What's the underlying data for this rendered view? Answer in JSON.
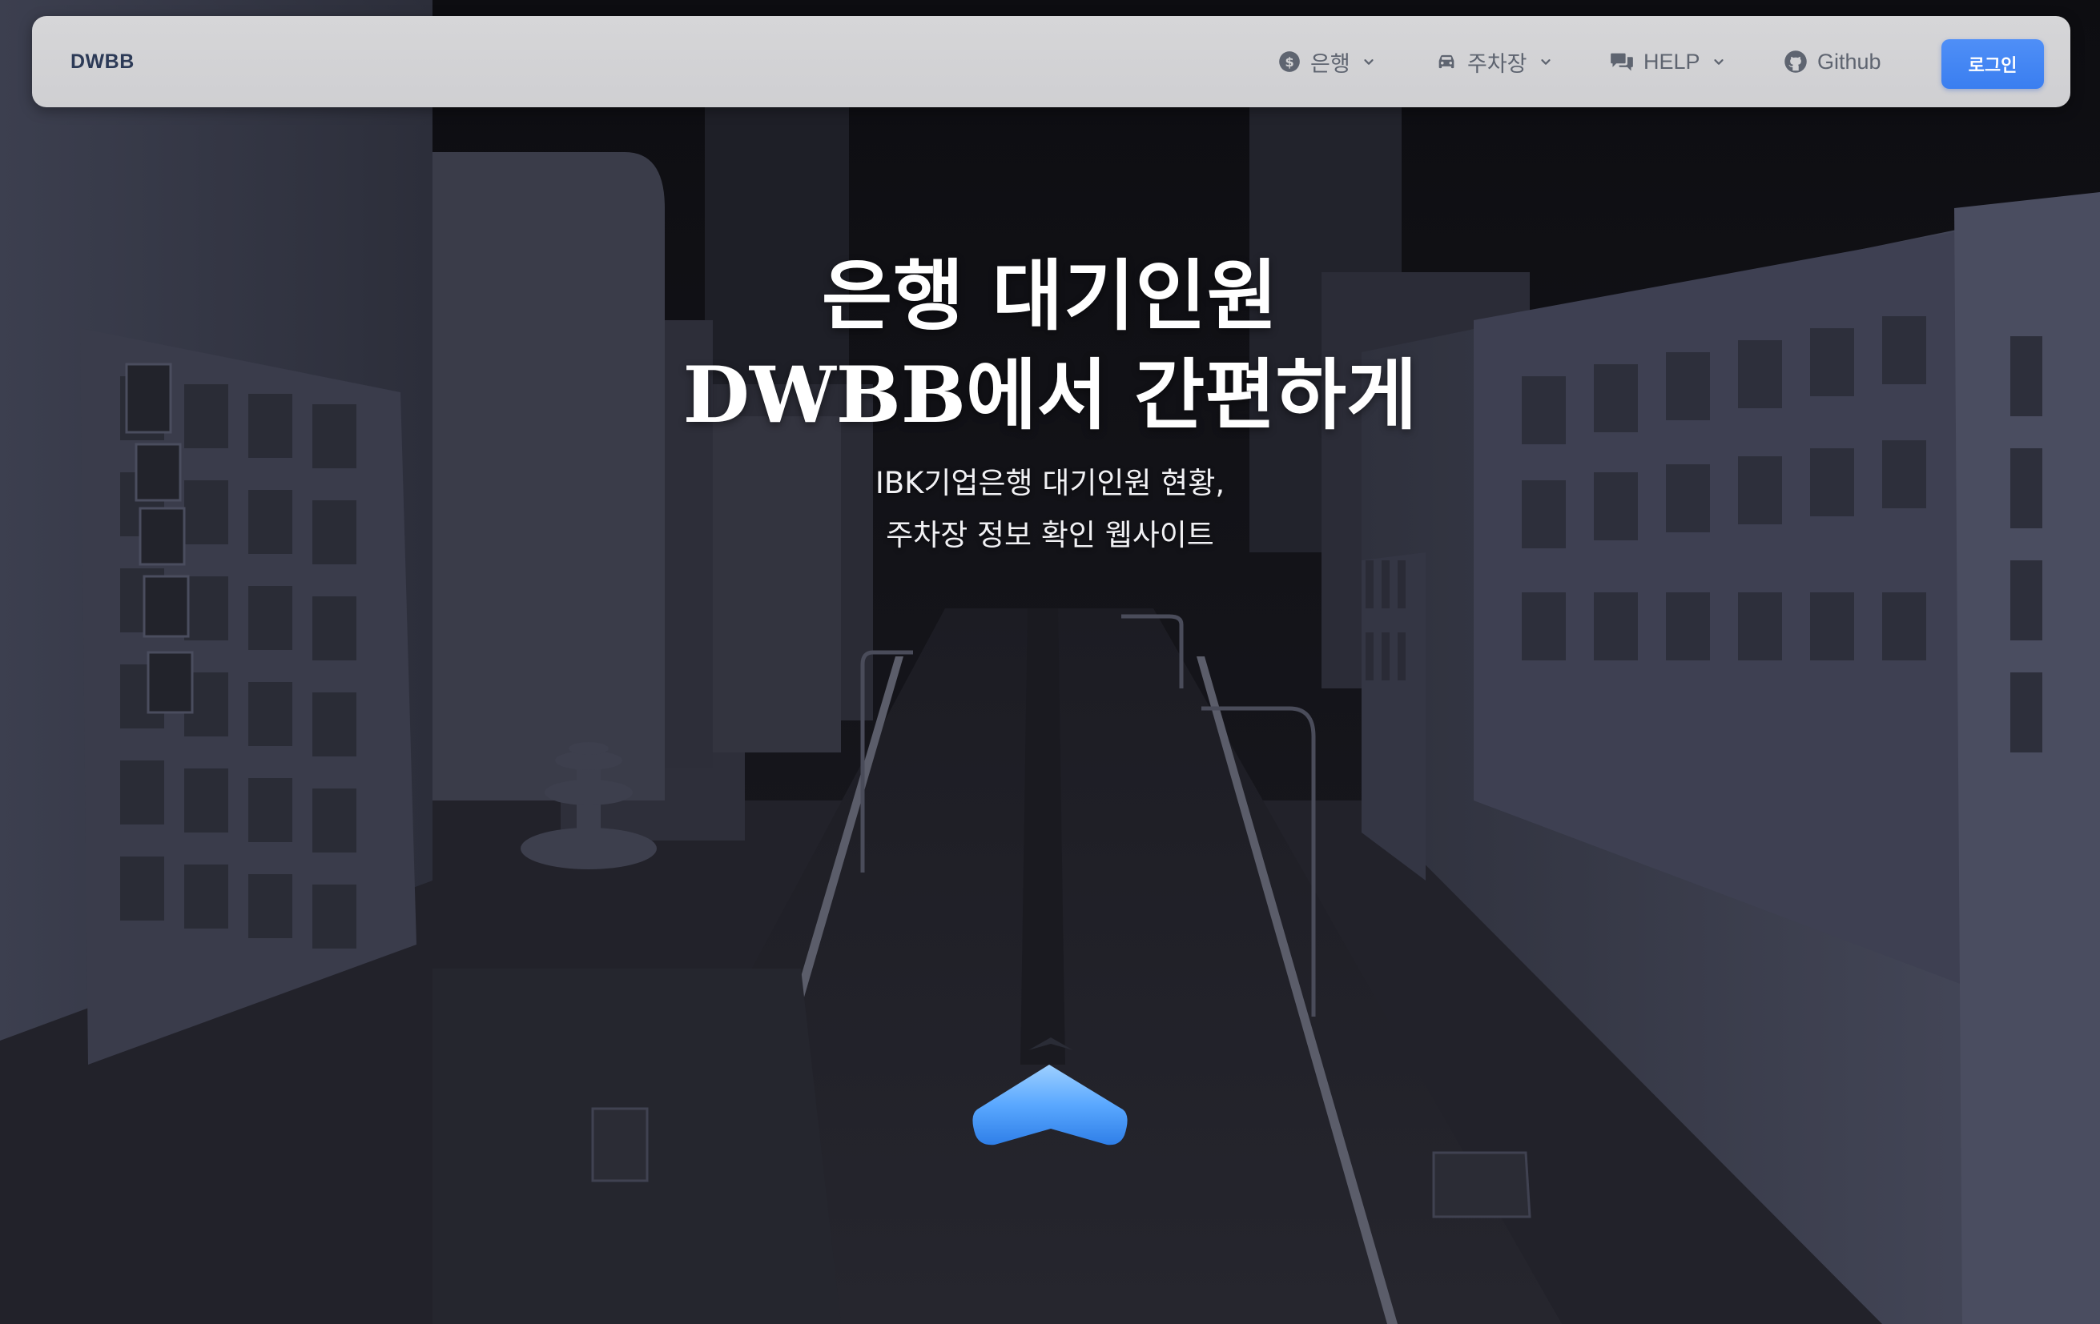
{
  "navbar": {
    "brand": "DWBB",
    "items": [
      {
        "label": "은행",
        "icon": "dollar-circle-icon",
        "has_dropdown": true
      },
      {
        "label": "주차장",
        "icon": "car-icon",
        "has_dropdown": true
      },
      {
        "label": "HELP",
        "icon": "chat-bubbles-icon",
        "has_dropdown": true
      },
      {
        "label": "Github",
        "icon": "github-icon",
        "has_dropdown": false
      }
    ],
    "login_label": "로그인"
  },
  "hero": {
    "title_line1": "은행 대기인원",
    "title_line2_brand": "DWBB",
    "title_line2_rest": "에서 간편하게",
    "subtitle_line1": "IBK기업은행 대기인원 현황,",
    "subtitle_line2": "주차장 정보 확인 웹사이트"
  },
  "colors": {
    "navbar_bg": "#d3d3d5",
    "brand_text": "#2c3a57",
    "nav_text": "#5e6470",
    "login_button": "#3f84f3",
    "scene_bg": "#1d1d24",
    "building": "#3a3c4a",
    "arrow": "#5aa8ff"
  }
}
